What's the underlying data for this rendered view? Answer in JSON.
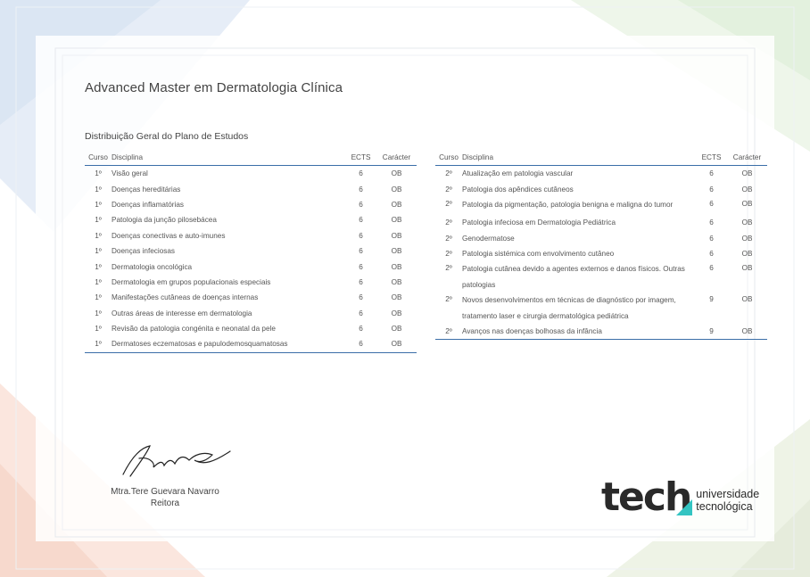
{
  "title": "Advanced Master em Dermatologia Clínica",
  "subtitle": "Distribuição Geral do Plano de Estudos",
  "headers": {
    "curso": "Curso",
    "disciplina": "Disciplina",
    "ects": "ECTS",
    "caracter": "Carácter"
  },
  "left_rows": [
    {
      "curso": "1º",
      "disciplina": "Visão geral",
      "ects": "6",
      "caracter": "OB"
    },
    {
      "curso": "1º",
      "disciplina": "Doenças hereditárias",
      "ects": "6",
      "caracter": "OB"
    },
    {
      "curso": "1º",
      "disciplina": "Doenças inflamatórias",
      "ects": "6",
      "caracter": "OB"
    },
    {
      "curso": "1º",
      "disciplina": "Patologia da junção pilosebácea",
      "ects": "6",
      "caracter": "OB"
    },
    {
      "curso": "1º",
      "disciplina": "Doenças conectivas e auto-imunes",
      "ects": "6",
      "caracter": "OB"
    },
    {
      "curso": "1º",
      "disciplina": "Doenças infeciosas",
      "ects": "6",
      "caracter": "OB"
    },
    {
      "curso": "1º",
      "disciplina": "Dermatologia oncológica",
      "ects": "6",
      "caracter": "OB"
    },
    {
      "curso": "1º",
      "disciplina": "Dermatologia em grupos populacionais especiais",
      "ects": "6",
      "caracter": "OB"
    },
    {
      "curso": "1º",
      "disciplina": " Manifestações cutâneas de doenças internas",
      "ects": "6",
      "caracter": "OB"
    },
    {
      "curso": "1º",
      "disciplina": "Outras áreas de interesse em dermatologia",
      "ects": "6",
      "caracter": "OB"
    },
    {
      "curso": "1º",
      "disciplina": "Revisão da patologia congénita e neonatal da pele",
      "ects": "6",
      "caracter": "OB"
    },
    {
      "curso": "1º",
      "disciplina": "Dermatoses eczematosas e papulodemosquamatosas",
      "ects": "6",
      "caracter": "OB"
    }
  ],
  "right_rows": [
    {
      "curso": "2º",
      "disciplina": "Atualização em patologia vascular",
      "ects": "6",
      "caracter": "OB"
    },
    {
      "curso": "2º",
      "disciplina": "Patologia dos apêndices cutâneos",
      "ects": "6",
      "caracter": "OB"
    },
    {
      "curso": "2º",
      "disciplina": "Patologia da pigmentação, patologia benigna e maligna do tumor",
      "ects": "6",
      "caracter": "OB"
    },
    {
      "curso": "2º",
      "disciplina": "Patologia infeciosa em Dermatologia Pediátrica",
      "ects": "6",
      "caracter": "OB"
    },
    {
      "curso": "2º",
      "disciplina": "Genodermatose",
      "ects": "6",
      "caracter": "OB"
    },
    {
      "curso": "2º",
      "disciplina": "Patologia sistémica com envolvimento cutâneo",
      "ects": "6",
      "caracter": "OB"
    },
    {
      "curso": "2º",
      "disciplina": "Patologia cutânea devido a agentes externos e danos físicos. Outras patologias",
      "ects": "6",
      "caracter": "OB"
    },
    {
      "curso": "2º",
      "disciplina": "Novos desenvolvimentos em técnicas de diagnóstico por imagem, tratamento laser e cirurgia dermatológica pediátrica",
      "ects": "9",
      "caracter": "OB"
    },
    {
      "curso": "2º",
      "disciplina": "Avanços nas doenças bolhosas da infância",
      "ects": "9",
      "caracter": "OB"
    }
  ],
  "signer": {
    "name": "Mtra.Tere Guevara Navarro",
    "role": "Reitora"
  },
  "logo": {
    "word": "tech",
    "line1": "universidade",
    "line2": "tecnológica",
    "accent_color": "#33c4c2"
  },
  "colors": {
    "rule": "#3b6ea8"
  }
}
